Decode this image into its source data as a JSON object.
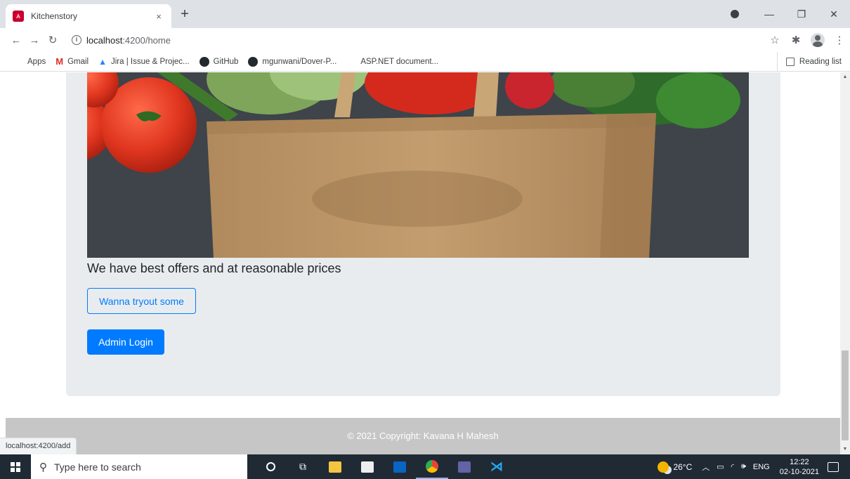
{
  "browser": {
    "tab": {
      "title": "Kitchenstory",
      "close": "×"
    },
    "new_tab": "+",
    "window": {
      "minimize": "—",
      "restore": "❐",
      "close": "✕"
    },
    "url": {
      "host": "localhost",
      "path": ":4200/home"
    },
    "bookmarks": [
      {
        "label": "Apps",
        "icon": "apps-grid-icon"
      },
      {
        "label": "Gmail",
        "icon": "gmail-icon",
        "glyph": "M"
      },
      {
        "label": "Jira | Issue & Projec...",
        "icon": "jira-icon",
        "glyph": "▲"
      },
      {
        "label": "GitHub",
        "icon": "github-icon"
      },
      {
        "label": "mgunwani/Dover-P...",
        "icon": "github-icon"
      },
      {
        "label": "ASP.NET document...",
        "icon": "microsoft-icon"
      }
    ],
    "reading_list": "Reading list",
    "status_url": "localhost:4200/add"
  },
  "page": {
    "tagline": "We have best offers and at reasonable prices",
    "tryout_button": "Wanna tryout some",
    "admin_button": "Admin Login",
    "footer": "© 2021 Copyright: Kavana H Mahesh"
  },
  "taskbar": {
    "search_placeholder": "Type here to search",
    "weather": "26°C",
    "language": "ENG",
    "time": "12:22",
    "date": "02-10-2021"
  },
  "colors": {
    "primary": "#007bff",
    "jumbotron": "#e9ecef",
    "footer": "#c6c6c6",
    "taskbar": "#1f2a35"
  }
}
